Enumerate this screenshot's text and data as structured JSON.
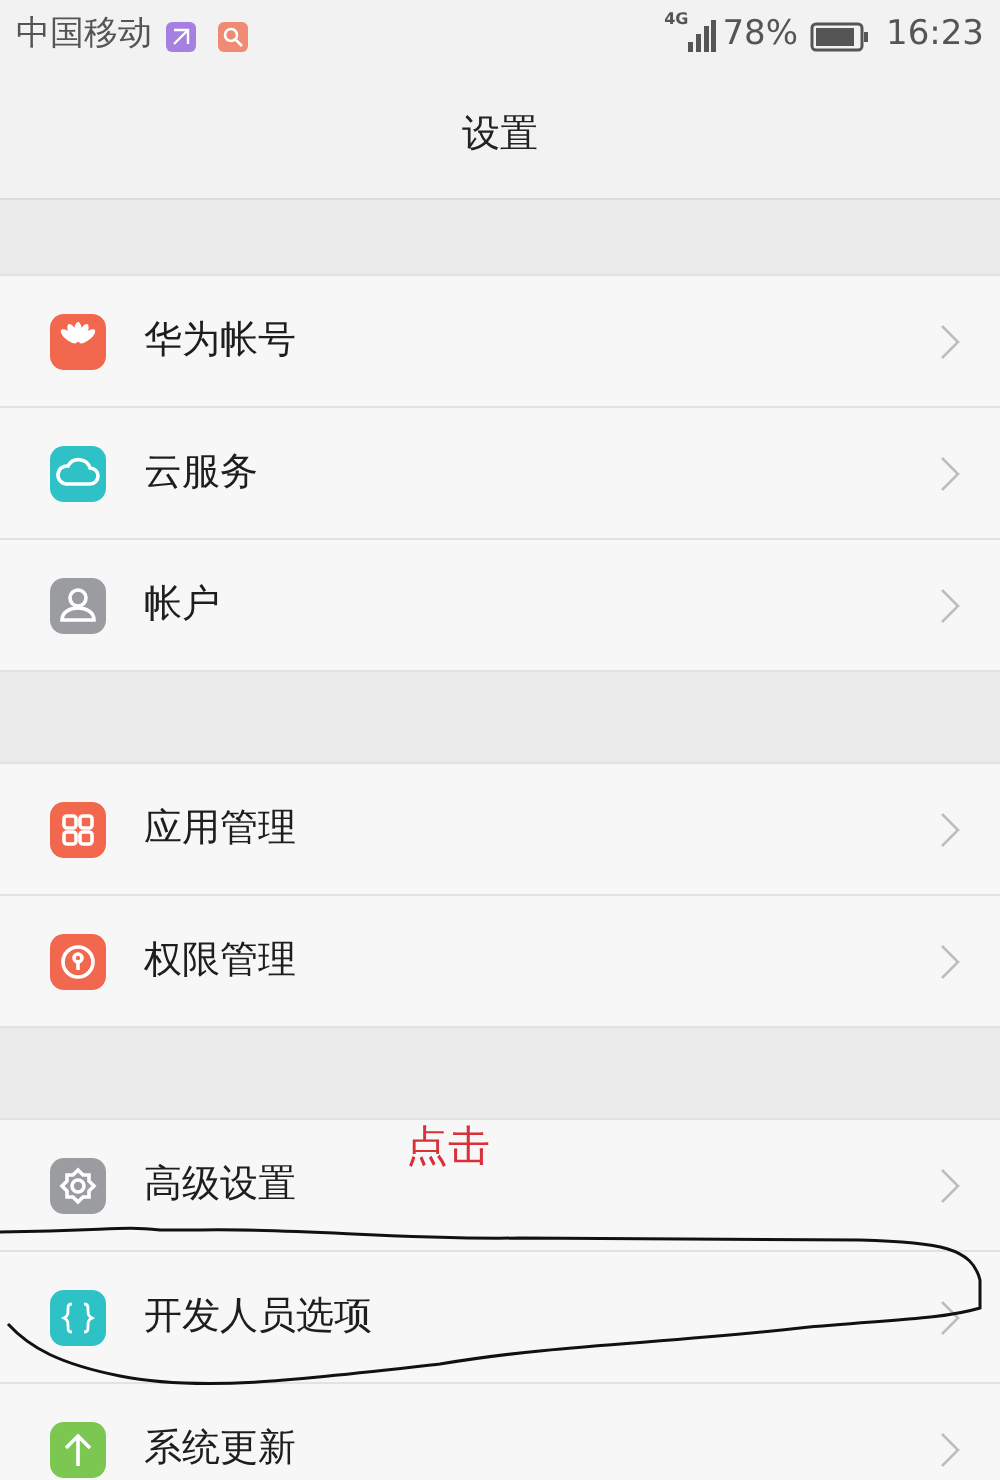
{
  "status_bar": {
    "carrier": "中国移动",
    "network": "4G",
    "battery": "78%",
    "time": "16:23"
  },
  "title": "设置",
  "groups": [
    {
      "items": [
        {
          "label": "华为帐号",
          "kind": "huawei",
          "color": "#f2684f"
        },
        {
          "label": "云服务",
          "kind": "cloud",
          "color": "#2ec2c6"
        },
        {
          "label": "帐户",
          "kind": "person",
          "color": "#9a9ca0"
        }
      ]
    },
    {
      "items": [
        {
          "label": "应用管理",
          "kind": "grid",
          "color": "#f2684f"
        },
        {
          "label": "权限管理",
          "kind": "lock",
          "color": "#f2684f"
        }
      ]
    },
    {
      "items": [
        {
          "label": "高级设置",
          "kind": "gear",
          "color": "#9a9ca0"
        },
        {
          "label": "开发人员选项",
          "kind": "braces",
          "color": "#2ec2c6"
        },
        {
          "label": "系统更新",
          "kind": "arrow",
          "color": "#7cc652"
        }
      ]
    }
  ],
  "annotation": {
    "text": "点击"
  }
}
